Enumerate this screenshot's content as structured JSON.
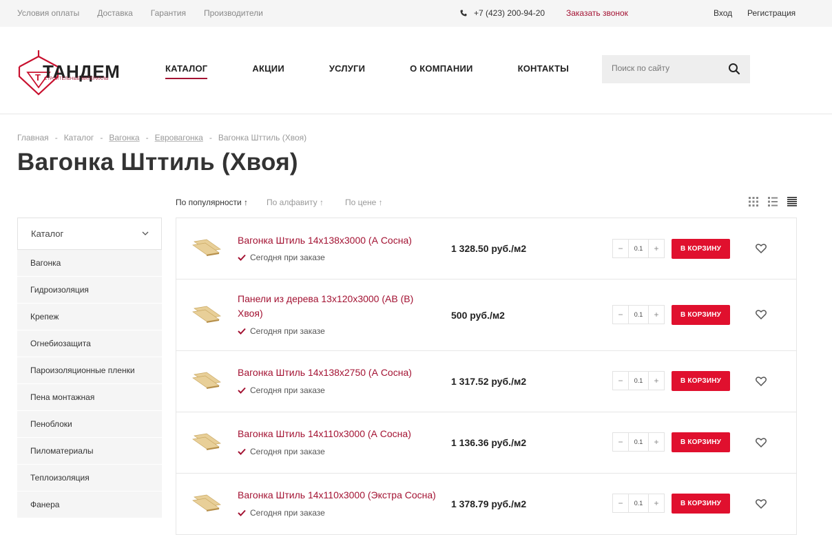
{
  "topbar": {
    "links": [
      "Условия оплаты",
      "Доставка",
      "Гарантия",
      "Производители"
    ],
    "phone": "+7 (423) 200-94-20",
    "callback": "Заказать звонок",
    "login": "Вход",
    "register": "Регистрация"
  },
  "logo": {
    "name": "ТАНДЕМ",
    "tagline": "СТРОИТЕЛЬНЫЕ МАТЕРИАЛЫ",
    "letter": "Т"
  },
  "nav": [
    {
      "label": "КАТАЛОГ",
      "active": true
    },
    {
      "label": "АКЦИИ"
    },
    {
      "label": "УСЛУГИ"
    },
    {
      "label": "О КОМПАНИИ"
    },
    {
      "label": "КОНТАКТЫ"
    }
  ],
  "search": {
    "placeholder": "Поиск по сайту"
  },
  "breadcrumb": [
    "Главная",
    "Каталог",
    "Вагонка",
    "Евровагонка",
    "Вагонка Шттиль (Хвоя)"
  ],
  "breadcrumb_sep": "-",
  "title": "Вагонка Шттиль (Хвоя)",
  "sort": [
    {
      "label": "По популярности ↑",
      "active": true
    },
    {
      "label": "По алфавиту ↑"
    },
    {
      "label": "По цене ↑"
    }
  ],
  "sidebar": {
    "title": "Каталог",
    "items": [
      "Вагонка",
      "Гидроизоляция",
      "Крепеж",
      "Огнебиозащита",
      "Пароизоляционные пленки",
      "Пена монтажная",
      "Пеноблоки",
      "Пиломатериалы",
      "Теплоизоляция",
      "Фанера"
    ]
  },
  "products": [
    {
      "name": "Вагонка Штиль 14х138х3000 (А Сосна)",
      "stock": "Сегодня при заказе",
      "price": "1 328.50 руб./м2",
      "qty": "0.1",
      "cart": "В КОРЗИНУ"
    },
    {
      "name": "Панели из дерева 13х120х3000 (АВ (В) Хвоя)",
      "stock": "Сегодня при заказе",
      "price": "500 руб./м2",
      "qty": "0.1",
      "cart": "В КОРЗИНУ"
    },
    {
      "name": "Вагонка Штиль 14х138х2750 (А Сосна)",
      "stock": "Сегодня при заказе",
      "price": "1 317.52 руб./м2",
      "qty": "0.1",
      "cart": "В КОРЗИНУ"
    },
    {
      "name": "Вагонка Штиль 14х110х3000 (А Сосна)",
      "stock": "Сегодня при заказе",
      "price": "1 136.36 руб./м2",
      "qty": "0.1",
      "cart": "В КОРЗИНУ"
    },
    {
      "name": "Вагонка Штиль 14х110х3000 (Экстра Сосна)",
      "stock": "Сегодня при заказе",
      "price": "1 378.79 руб./м2",
      "qty": "0.1",
      "cart": "В КОРЗИНУ"
    }
  ],
  "icons": {
    "minus": "−",
    "plus": "+"
  },
  "colors": {
    "accent": "#a31232",
    "button": "#e0102e",
    "bar": "#f5f5f5"
  }
}
